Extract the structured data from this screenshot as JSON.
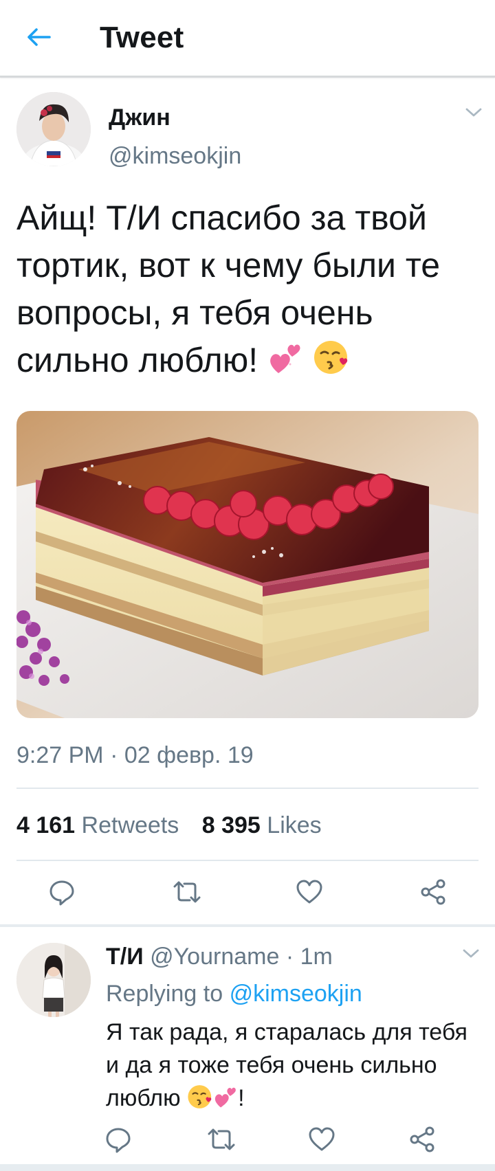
{
  "header": {
    "title": "Tweet",
    "back_icon": "arrow-left-icon"
  },
  "tweet": {
    "author_name": "Джин",
    "handle": "@kimseokjin",
    "text": "Айщ! Т/И спасибо за твой тортик, вот к чему были те вопросы, я тебя очень сильно люблю!",
    "text_emojis": [
      "two-hearts-emoji",
      "face-blowing-kiss-emoji"
    ],
    "image": "layered-cake-with-raspberries",
    "timestamp": "9:27 PM · 02 февр. 19",
    "retweets_count": "4 161",
    "retweets_label": "Retweets",
    "likes_count": "8 395",
    "likes_label": "Likes",
    "actions": [
      "reply-icon",
      "retweet-icon",
      "like-icon",
      "share-icon"
    ]
  },
  "reply": {
    "author_name": "Т/И",
    "handle": "@Yourname",
    "time": "1m",
    "replying_to_label": "Replying to",
    "replying_to_handle": "@kimseokjin",
    "text": "Я так рада, я старалась для тебя и да я тоже тебя очень сильно люблю",
    "text_suffix": "!",
    "text_emojis": [
      "face-blowing-kiss-emoji",
      "two-hearts-emoji"
    ],
    "actions": [
      "reply-icon",
      "retweet-icon",
      "like-icon",
      "share-icon"
    ]
  },
  "colors": {
    "accent": "#1da1f2",
    "muted": "#657786",
    "text": "#14171a",
    "divider": "#e1e8ed"
  }
}
